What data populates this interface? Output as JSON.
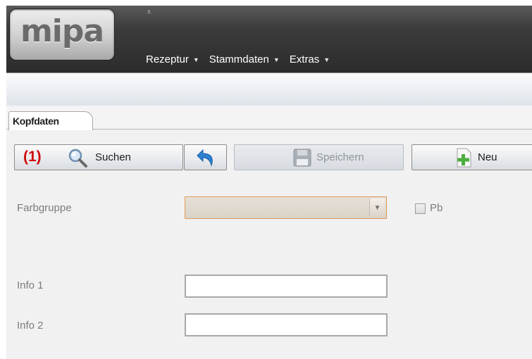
{
  "header": {
    "logo_text": "mipa",
    "quick_access_glyph": "⩡",
    "menu": [
      {
        "label": "Rezeptur"
      },
      {
        "label": "Stammdaten"
      },
      {
        "label": "Extras"
      }
    ],
    "menu_arrow": "▼"
  },
  "tabs": [
    {
      "label": "Kopfdaten",
      "active": true
    }
  ],
  "toolbar": {
    "marker": "(1)",
    "search_label": "Suchen",
    "save_label": "Speichern",
    "new_label": "Neu"
  },
  "form": {
    "farbgruppe_label": "Farbgruppe",
    "farbgruppe_value": "",
    "pb_label": "Pb",
    "pb_checked": false,
    "info1_label": "Info 1",
    "info1_value": "",
    "info2_label": "Info 2",
    "info2_value": ""
  },
  "colors": {
    "header_dark": "#3a3a3a",
    "marker_red": "#cf0b0b",
    "combo_border": "#e39a57",
    "plus_green": "#4cae3f",
    "undo_blue": "#2f7fd0"
  },
  "icons": {
    "search": "magnifier-icon",
    "undo": "undo-icon",
    "save": "floppy-disk-icon",
    "new": "new-document-icon",
    "combo": "chevron-down-icon"
  }
}
